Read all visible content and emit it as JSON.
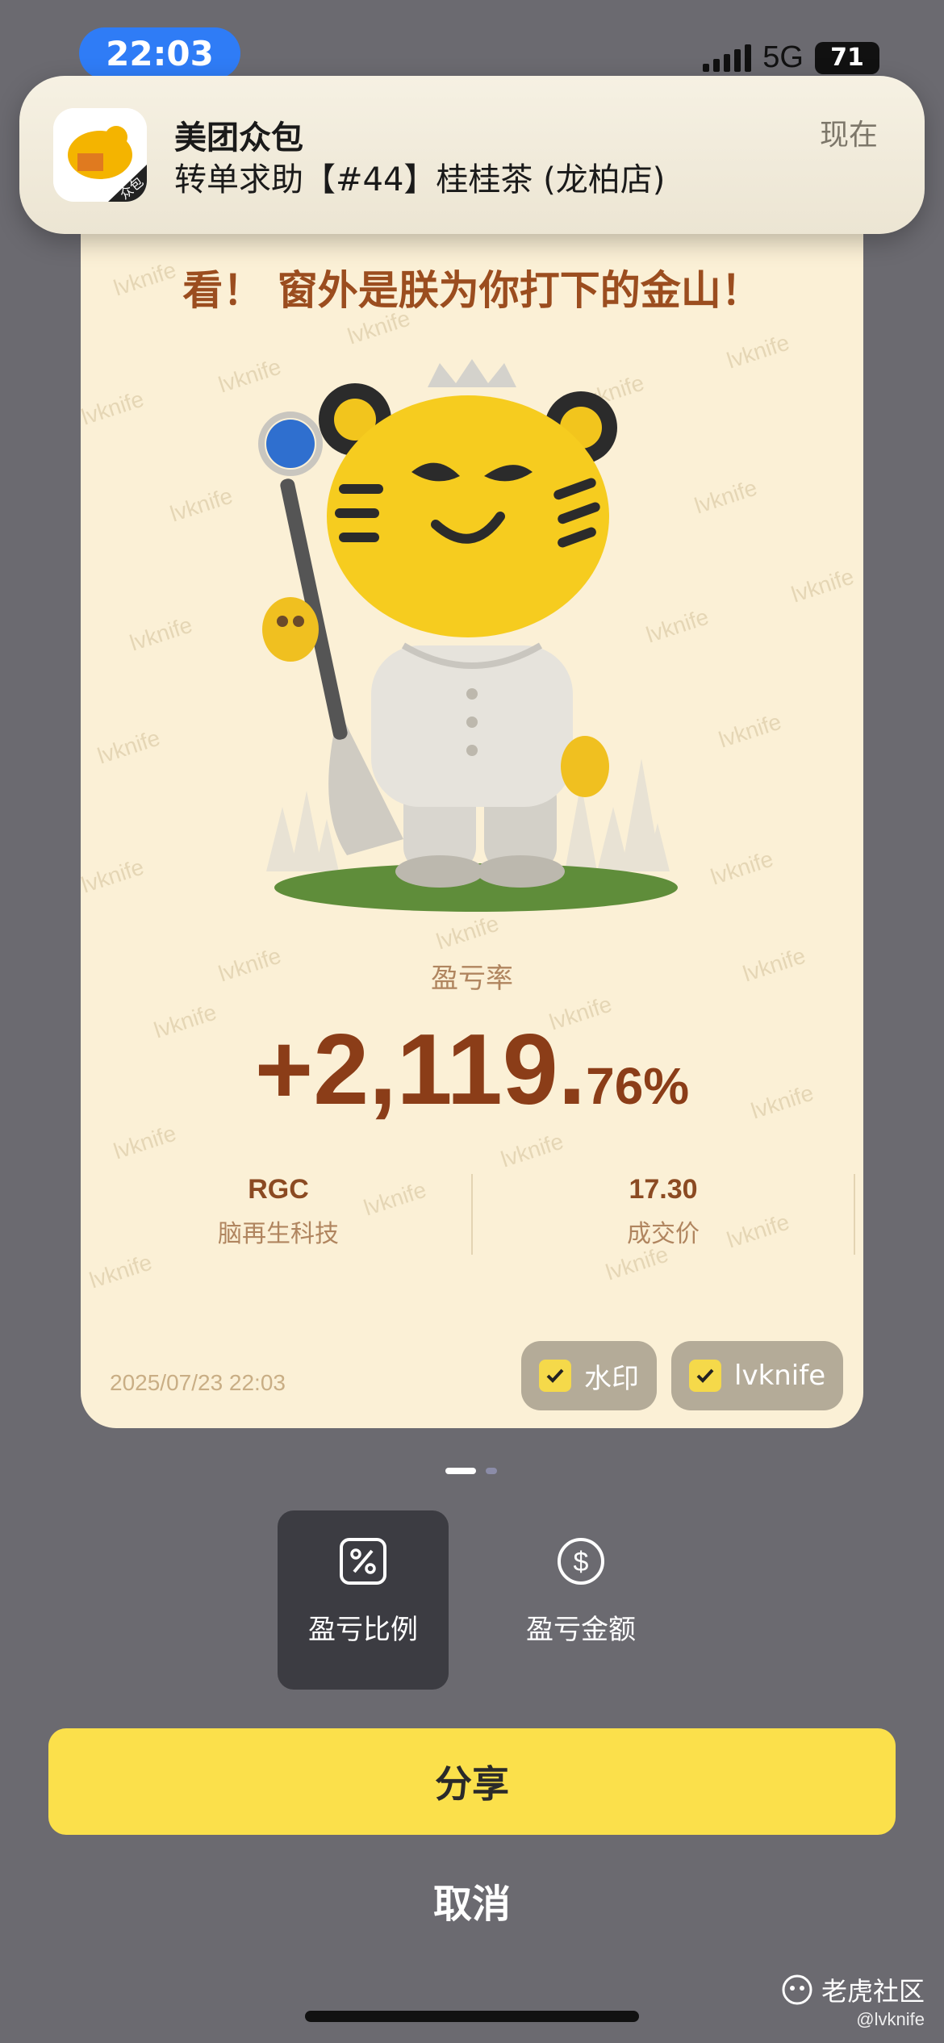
{
  "status_bar": {
    "time": "22:03",
    "network": "5G",
    "battery": "71"
  },
  "notification": {
    "app_name": "美团众包",
    "message": "转单求助【#44】桂桂茶 (龙柏店)",
    "time": "现在",
    "icon_badge": "众包"
  },
  "card": {
    "headline": "看！ 窗外是朕为你打下的金山！",
    "watermark_text": "lvknife",
    "rate_label": "盈亏率",
    "rate_main": "+2,119.",
    "rate_decimal": "76%",
    "left_stat": {
      "value": "RGC",
      "label": "脑再生科技"
    },
    "right_stat": {
      "value": "17.30",
      "label": "成交价"
    },
    "date": "2025/07/23 22:03",
    "chip_watermark": "水印",
    "chip_name": "lvknife"
  },
  "pager": {
    "current": 1,
    "total": 2
  },
  "modes": {
    "ratio_label": "盈亏比例",
    "amount_label": "盈亏金额",
    "ratio_icon": "percent-icon",
    "amount_icon": "dollar-icon"
  },
  "actions": {
    "share_label": "分享",
    "cancel_label": "取消"
  },
  "corner_watermark": {
    "brand": "老虎社区",
    "handle": "@lvknife"
  },
  "colors": {
    "share_button": "#fbe04b",
    "rate_text": "#8b3d18",
    "card_bg": "#fbf0d6"
  }
}
